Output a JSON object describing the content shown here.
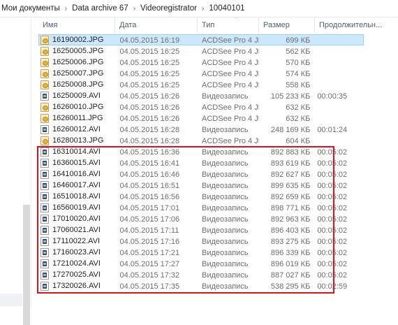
{
  "breadcrumb": [
    "Мои документы",
    "Data archive 67",
    "Videoregistrator",
    "10040101"
  ],
  "breadcrumb_separator": "›",
  "columns": {
    "name": "Имя",
    "date": "Дата",
    "type": "Тип",
    "size": "Размер",
    "duration": "Продолжительн..."
  },
  "sort_indicator": "^",
  "highlight_color": "#e0101e",
  "selection_color": "#cce8ff",
  "files": [
    {
      "name": "16190002.JPG",
      "date": "04.05.2015 16:19",
      "type": "ACDSee Pro 4 JPE...",
      "size": "699 КБ",
      "duration": "",
      "icon": "jpg-icon"
    },
    {
      "name": "16250005.JPG",
      "date": "04.05.2015 16:25",
      "type": "ACDSee Pro 4 JPE...",
      "size": "562 КБ",
      "duration": "",
      "icon": "jpg-icon"
    },
    {
      "name": "16250006.JPG",
      "date": "04.05.2015 16:25",
      "type": "ACDSee Pro 4 JPE...",
      "size": "570 КБ",
      "duration": "",
      "icon": "jpg-icon"
    },
    {
      "name": "16250007.JPG",
      "date": "04.05.2015 16:25",
      "type": "ACDSee Pro 4 JPE...",
      "size": "574 КБ",
      "duration": "",
      "icon": "jpg-icon"
    },
    {
      "name": "16250008.JPG",
      "date": "04.05.2015 16:25",
      "type": "ACDSee Pro 4 JPE...",
      "size": "558 КБ",
      "duration": "",
      "icon": "jpg-icon"
    },
    {
      "name": "16250009.AVI",
      "date": "04.05.2015 16:26",
      "type": "Видеозапись",
      "size": "105 233 КБ",
      "duration": "00:00:35",
      "icon": "avi-icon"
    },
    {
      "name": "16260010.JPG",
      "date": "04.05.2015 16:26",
      "type": "ACDSee Pro 4 JPE...",
      "size": "632 КБ",
      "duration": "",
      "icon": "jpg-icon"
    },
    {
      "name": "16260011.JPG",
      "date": "04.05.2015 16:26",
      "type": "ACDSee Pro 4 JPE...",
      "size": "632 КБ",
      "duration": "",
      "icon": "jpg-icon"
    },
    {
      "name": "16260012.AVI",
      "date": "04.05.2015 16:28",
      "type": "Видеозапись",
      "size": "248 169 КБ",
      "duration": "00:01:24",
      "icon": "avi-icon"
    },
    {
      "name": "16280013.JPG",
      "date": "04.05.2015 16:28",
      "type": "ACDSee Pro 4 JPE...",
      "size": "604 КБ",
      "duration": "",
      "icon": "jpg-icon"
    },
    {
      "name": "16310014.AVI",
      "date": "04.05.2015 16:36",
      "type": "Видеозапись",
      "size": "892 883 КБ",
      "duration": "00:05:02",
      "icon": "avi-icon"
    },
    {
      "name": "16360015.AVI",
      "date": "04.05.2015 16:41",
      "type": "Видеозапись",
      "size": "893 619 КБ",
      "duration": "00:05:02",
      "icon": "avi-icon"
    },
    {
      "name": "16410016.AVI",
      "date": "04.05.2015 16:46",
      "type": "Видеозапись",
      "size": "892 627 КБ",
      "duration": "00:05:02",
      "icon": "avi-icon"
    },
    {
      "name": "16460017.AVI",
      "date": "04.05.2015 16:51",
      "type": "Видеозапись",
      "size": "899 635 КБ",
      "duration": "00:05:02",
      "icon": "avi-icon"
    },
    {
      "name": "16510018.AVI",
      "date": "04.05.2015 16:56",
      "type": "Видеозапись",
      "size": "892 659 КБ",
      "duration": "00:05:02",
      "icon": "avi-icon"
    },
    {
      "name": "16560019.AVI",
      "date": "04.05.2015 17:01",
      "type": "Видеозапись",
      "size": "898 771 КБ",
      "duration": "00:05:02",
      "icon": "avi-icon"
    },
    {
      "name": "17010020.AVI",
      "date": "04.05.2015 17:06",
      "type": "Видеозапись",
      "size": "892 963 КБ",
      "duration": "00:05:02",
      "icon": "avi-icon"
    },
    {
      "name": "17060021.AVI",
      "date": "04.05.2015 17:11",
      "type": "Видеозапись",
      "size": "896 403 КБ",
      "duration": "00:05:02",
      "icon": "avi-icon"
    },
    {
      "name": "17110022.AVI",
      "date": "04.05.2015 17:16",
      "type": "Видеозапись",
      "size": "893 275 КБ",
      "duration": "00:05:02",
      "icon": "avi-icon"
    },
    {
      "name": "17160023.AVI",
      "date": "04.05.2015 17:21",
      "type": "Видеозапись",
      "size": "896 339 КБ",
      "duration": "00:05:02",
      "icon": "avi-icon"
    },
    {
      "name": "17210024.AVI",
      "date": "04.05.2015 17:27",
      "type": "Видеозапись",
      "size": "896 019 КБ",
      "duration": "00:05:02",
      "icon": "avi-icon"
    },
    {
      "name": "17270025.AVI",
      "date": "04.05.2015 17:32",
      "type": "Видеозапись",
      "size": "887 027 КБ",
      "duration": "00:05:02",
      "icon": "avi-icon"
    },
    {
      "name": "17320026.AVI",
      "date": "04.05.2015 17:35",
      "type": "Видеозапись",
      "size": "538 295 КБ",
      "duration": "00:02:59",
      "icon": "avi-icon"
    }
  ],
  "selected_index": 0
}
